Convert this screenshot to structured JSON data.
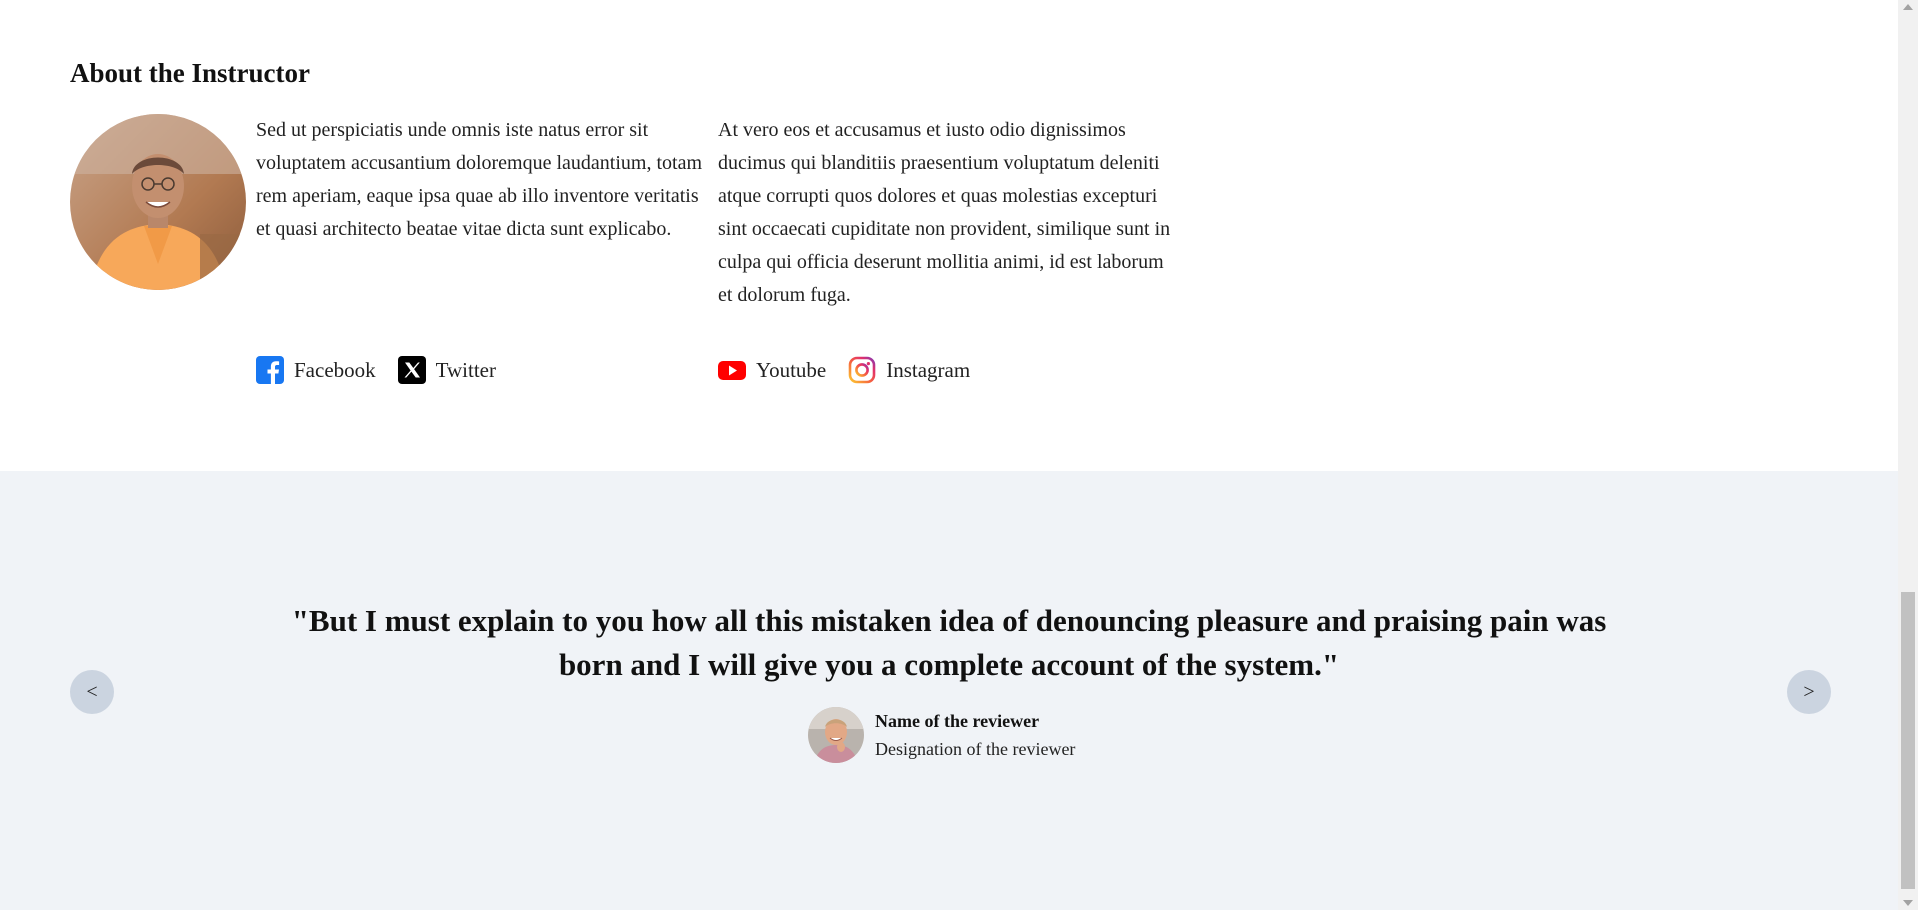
{
  "about": {
    "title": "About the Instructor",
    "bio_left": "Sed ut perspiciatis unde omnis iste natus error sit voluptatem accusantium doloremque laudantium, totam rem aperiam, eaque ipsa quae ab illo inventore veritatis et quasi architecto beatae vitae dicta sunt explicabo.",
    "bio_right": "At vero eos et accusamus et iusto odio dignissimos ducimus qui blanditiis praesentium voluptatum deleniti atque corrupti quos dolores et quas molestias excepturi sint occaecati cupiditate non provident, similique sunt in culpa qui officia deserunt mollitia animi, id est laborum\net dolorum fuga.",
    "socials_left": [
      {
        "label": "Facebook",
        "icon": "facebook-icon",
        "color": "#1877f2"
      },
      {
        "label": "Twitter",
        "icon": "x-twitter-icon",
        "color": "#000000"
      }
    ],
    "socials_right": [
      {
        "label": "Youtube",
        "icon": "youtube-icon",
        "color": "#ff0000"
      },
      {
        "label": "Instagram",
        "icon": "instagram-icon",
        "color": "#e1306c"
      }
    ]
  },
  "testimonial": {
    "quote": "\"But I must explain to you how all this mistaken idea of denouncing pleasure and praising pain was born and I will give you a complete account of the system.\"",
    "reviewer_name": "Name of the reviewer",
    "reviewer_designation": "Designation of the reviewer",
    "prev_label": "<",
    "next_label": ">",
    "background": "#f0f3f7",
    "nav_button_color": "#cbd4e0"
  }
}
